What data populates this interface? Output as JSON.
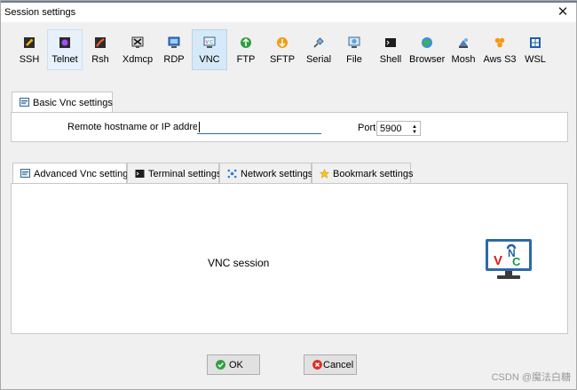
{
  "window": {
    "title": "Session settings",
    "close_glyph": "✕"
  },
  "session_types": [
    {
      "label": "SSH",
      "icon": "ssh-icon"
    },
    {
      "label": "Telnet",
      "icon": "telnet-icon"
    },
    {
      "label": "Rsh",
      "icon": "rsh-icon"
    },
    {
      "label": "Xdmcp",
      "icon": "xdmcp-icon"
    },
    {
      "label": "RDP",
      "icon": "rdp-icon"
    },
    {
      "label": "VNC",
      "icon": "vnc-icon",
      "selected": true
    },
    {
      "label": "FTP",
      "icon": "ftp-icon"
    },
    {
      "label": "SFTP",
      "icon": "sftp-icon"
    },
    {
      "label": "Serial",
      "icon": "serial-icon"
    },
    {
      "label": "File",
      "icon": "file-icon"
    },
    {
      "label": "Shell",
      "icon": "shell-icon"
    },
    {
      "label": "Browser",
      "icon": "browser-icon"
    },
    {
      "label": "Mosh",
      "icon": "mosh-icon"
    },
    {
      "label": "Aws S3",
      "icon": "aws-s3-icon"
    },
    {
      "label": "WSL",
      "icon": "wsl-icon"
    }
  ],
  "basic_tab": {
    "label": "Basic Vnc settings"
  },
  "basic": {
    "host_label": "Remote hostname or IP address *",
    "host_value": "",
    "port_label": "Port",
    "port_value": "5900"
  },
  "advanced_tabs": [
    {
      "label": "Advanced Vnc settings",
      "icon": "settings-window-icon"
    },
    {
      "label": "Terminal settings",
      "icon": "terminal-icon"
    },
    {
      "label": "Network settings",
      "icon": "network-icon"
    },
    {
      "label": "Bookmark settings",
      "icon": "star-icon"
    }
  ],
  "content": {
    "caption": "VNC session",
    "logo_letters": [
      "V",
      "N",
      "C"
    ]
  },
  "buttons": {
    "ok": "OK",
    "cancel": "Cancel"
  },
  "watermark": "CSDN @魔法白糖",
  "colors": {
    "accent": "#1f6fb8",
    "selected_bg": "#d6e9f8",
    "ok_green": "#2e9e3e",
    "cancel_red": "#d93025"
  }
}
